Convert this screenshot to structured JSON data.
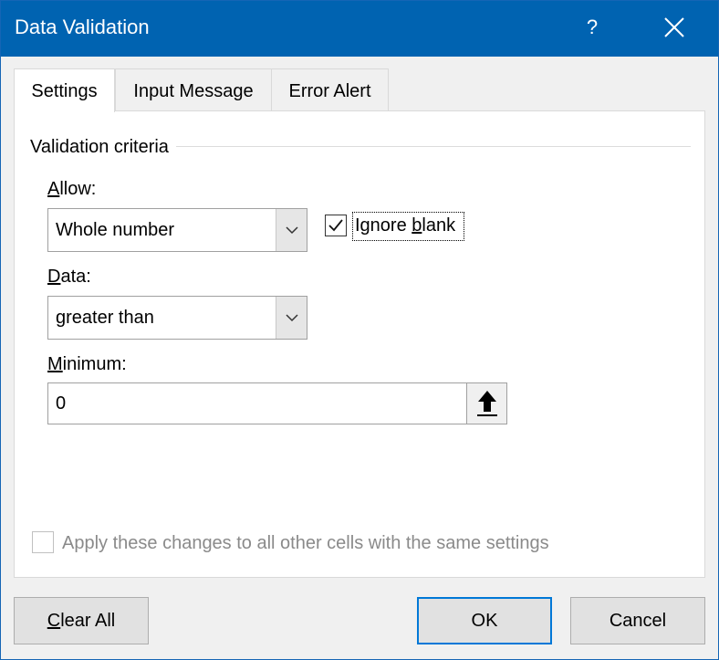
{
  "window": {
    "title": "Data Validation",
    "help_glyph": "?",
    "close_icon": "close-icon",
    "titlebar_color": "#0063b1"
  },
  "tabs": [
    {
      "label": "Settings",
      "active": true
    },
    {
      "label": "Input Message",
      "active": false
    },
    {
      "label": "Error Alert",
      "active": false
    }
  ],
  "settings": {
    "group_label": "Validation criteria",
    "allow": {
      "label_mnemonic": "A",
      "label_rest": "llow:",
      "value": "Whole number"
    },
    "ignore_blank": {
      "checked": true,
      "label_pre": "Ignore ",
      "label_mnemonic": "b",
      "label_post": "lank"
    },
    "data": {
      "label_mnemonic": "D",
      "label_rest": "ata:",
      "value": "greater than"
    },
    "minimum": {
      "label_mnemonic": "M",
      "label_rest": "inimum:",
      "value": "0",
      "collapse_icon": "arrow-up-icon"
    },
    "apply_all": {
      "checked": false,
      "enabled": false,
      "label": "Apply these changes to all other cells with the same settings"
    }
  },
  "buttons": {
    "clear_all_mnemonic": "C",
    "clear_all_rest": "lear All",
    "ok": "OK",
    "cancel": "Cancel"
  },
  "colors": {
    "accent": "#0078d7",
    "disabled_text": "#8a8a8a"
  }
}
